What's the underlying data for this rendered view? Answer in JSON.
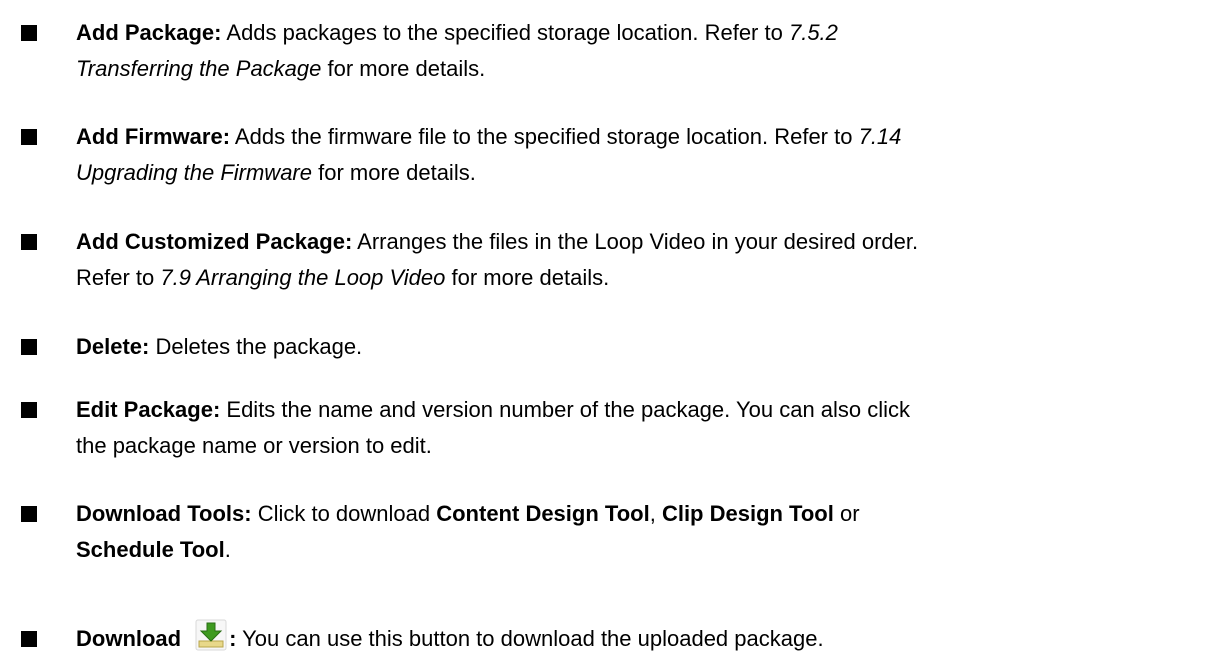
{
  "items": [
    {
      "label": "Add Package:",
      "line1": " Adds packages to the specified storage location. Refer to ",
      "ref_a": "7.5.2",
      "ref_b": "Transferring the Package",
      "line2_rest": " for more details."
    },
    {
      "label": "Add Firmware:",
      "line1": " Adds the firmware file to the specified storage location. Refer to ",
      "ref_a": "7.14",
      "ref_b": "Upgrading the Firmware",
      "line2_rest": " for more details."
    },
    {
      "label": "Add Customized Package:",
      "line1": " Arranges the files in the Loop Video in your desired order.",
      "line2_pre": "Refer to ",
      "ref": "7.9 Arranging the Loop Video",
      "line2_rest": " for more details."
    },
    {
      "label": "Delete:",
      "line1": " Deletes the package."
    },
    {
      "label": "Edit Package:",
      "line1": " Edits the name and version number of the package. You can also click",
      "line2": "the package name or version to edit."
    },
    {
      "label": "Download Tools:",
      "line1": " Click to download ",
      "tool1": "Content Design Tool",
      "sep1": ", ",
      "tool2": "Clip Design Tool",
      "sep2": " or",
      "tool3": "Schedule Tool",
      "end": "."
    },
    {
      "label": "Download",
      "icon": "download-arrow-icon",
      "colon": ":",
      "line1": " You can use this button to download the uploaded package."
    }
  ],
  "colors": {
    "text": "#000000",
    "icon_arrow": "#3e9a1f",
    "icon_base": "#e8d88a"
  }
}
